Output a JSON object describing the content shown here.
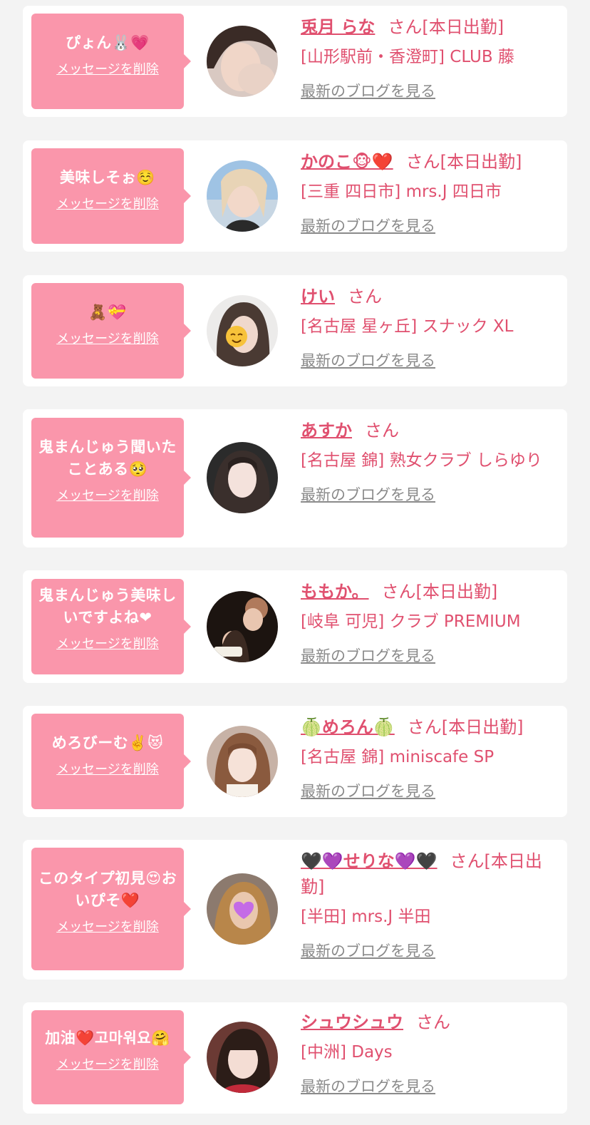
{
  "delete_label": "メッセージを削除",
  "san_label": "さん",
  "blog_label": "最新のブログを見る",
  "colors": {
    "background": "#f3f3f3",
    "card": "#ffffff",
    "bubble": "#fa96ab",
    "accent_text": "#e0506f",
    "link_gray": "#8a8a8a"
  },
  "entries": [
    {
      "message": "ぴょん🐰💗",
      "name": "兎月 らな",
      "status": "[本日出勤]",
      "shop": "[山形駅前・香澄町] CLUB 藤",
      "avatar_icon": "profile-photo"
    },
    {
      "message": "美味しそぉ☺️",
      "name": "かのこ🐵❤️",
      "status": "[本日出勤]",
      "shop": "[三重 四日市] mrs.J 四日市",
      "avatar_icon": "profile-photo"
    },
    {
      "message": "🧸💝",
      "name": "けい",
      "status": "",
      "shop": "[名古屋 星ヶ丘] スナック XL",
      "avatar_icon": "profile-photo"
    },
    {
      "message": "鬼まんじゅう聞いたことある🥺",
      "name": "あすか",
      "status": "",
      "shop": "[名古屋 錦] 熟女クラブ しらゆり",
      "avatar_icon": "profile-photo"
    },
    {
      "message": "鬼まんじゅう美味しいですよね❤",
      "name": "ももか。",
      "status": "[本日出勤]",
      "shop": "[岐阜 可児] クラブ PREMIUM",
      "avatar_icon": "profile-photo"
    },
    {
      "message": "めろびーむ✌️😻",
      "name": "🍈めろん🍈",
      "status": "[本日出勤]",
      "shop": "[名古屋 錦] miniscafe SP",
      "avatar_icon": "profile-photo"
    },
    {
      "message": "このタイプ初見😍おいぴそ❤️",
      "name": "🖤💜せりな💜🖤",
      "status": "[本日出勤]",
      "shop": "[半田] mrs.J 半田",
      "avatar_icon": "profile-photo"
    },
    {
      "message": "加油❤️고마워요🤗",
      "name": "シュウシュウ",
      "status": "",
      "shop": "[中洲] Days",
      "avatar_icon": "profile-photo"
    }
  ]
}
